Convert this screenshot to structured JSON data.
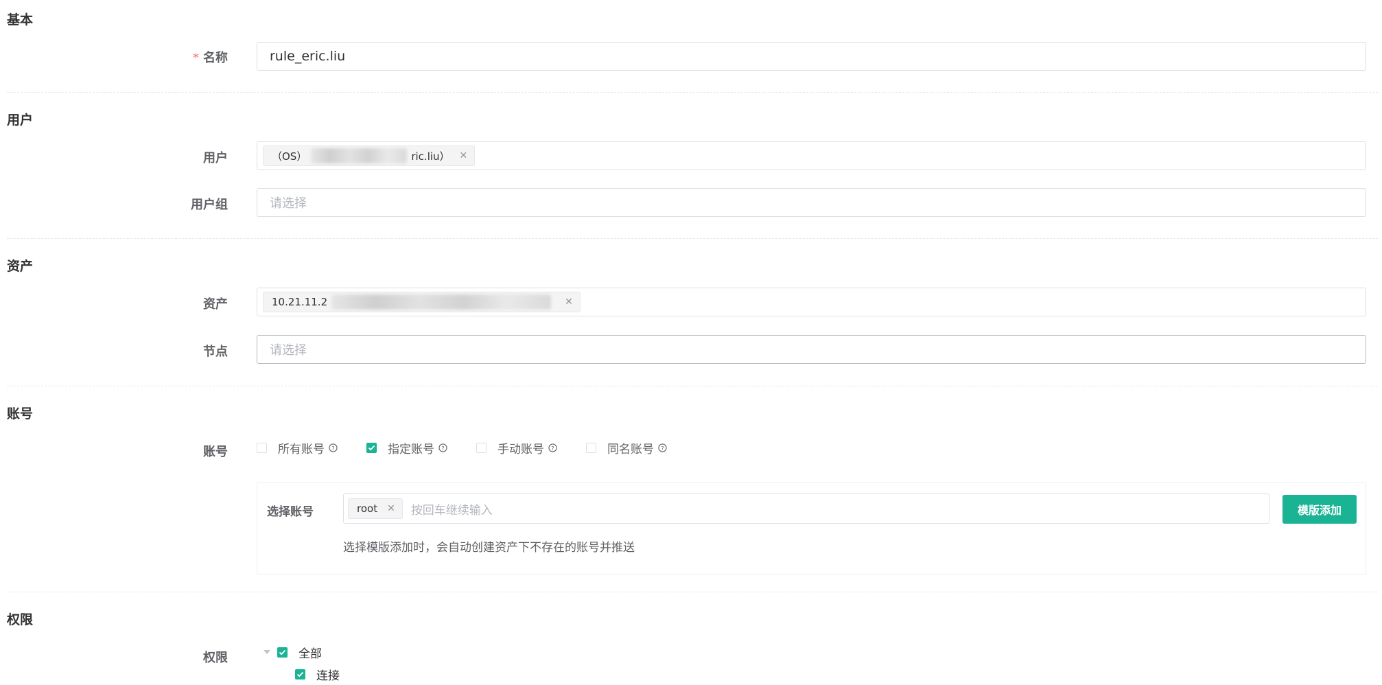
{
  "sections": {
    "basic": "基本",
    "user": "用户",
    "asset": "资产",
    "account": "账号",
    "permission": "权限"
  },
  "basic": {
    "name_label": "名称",
    "required_mark": "*",
    "name_value": "rule_eric.liu"
  },
  "users": {
    "user_label": "用户",
    "user_tag_prefix": "（OS）",
    "user_tag_suffix": "ric.liu）",
    "group_label": "用户组",
    "group_placeholder": "请选择"
  },
  "assets": {
    "asset_label": "资产",
    "asset_tag_prefix": "10.21.11.2",
    "node_label": "节点",
    "node_placeholder": "请选择"
  },
  "account": {
    "label": "账号",
    "options": [
      {
        "label": "所有账号",
        "checked": false
      },
      {
        "label": "指定账号",
        "checked": true
      },
      {
        "label": "手动账号",
        "checked": false
      },
      {
        "label": "同名账号",
        "checked": false
      }
    ],
    "select_label": "选择账号",
    "selected_tag": "root",
    "input_placeholder": "按回车继续输入",
    "template_button": "模版添加",
    "hint": "选择模版添加时，会自动创建资产下不存在的账号并推送"
  },
  "permission": {
    "label": "权限",
    "tree": [
      {
        "label": "全部",
        "checked": true,
        "expanded": true
      },
      {
        "label": "连接",
        "checked": true
      }
    ]
  },
  "colors": {
    "accent": "#1ab394",
    "required": "#f56c6c"
  }
}
